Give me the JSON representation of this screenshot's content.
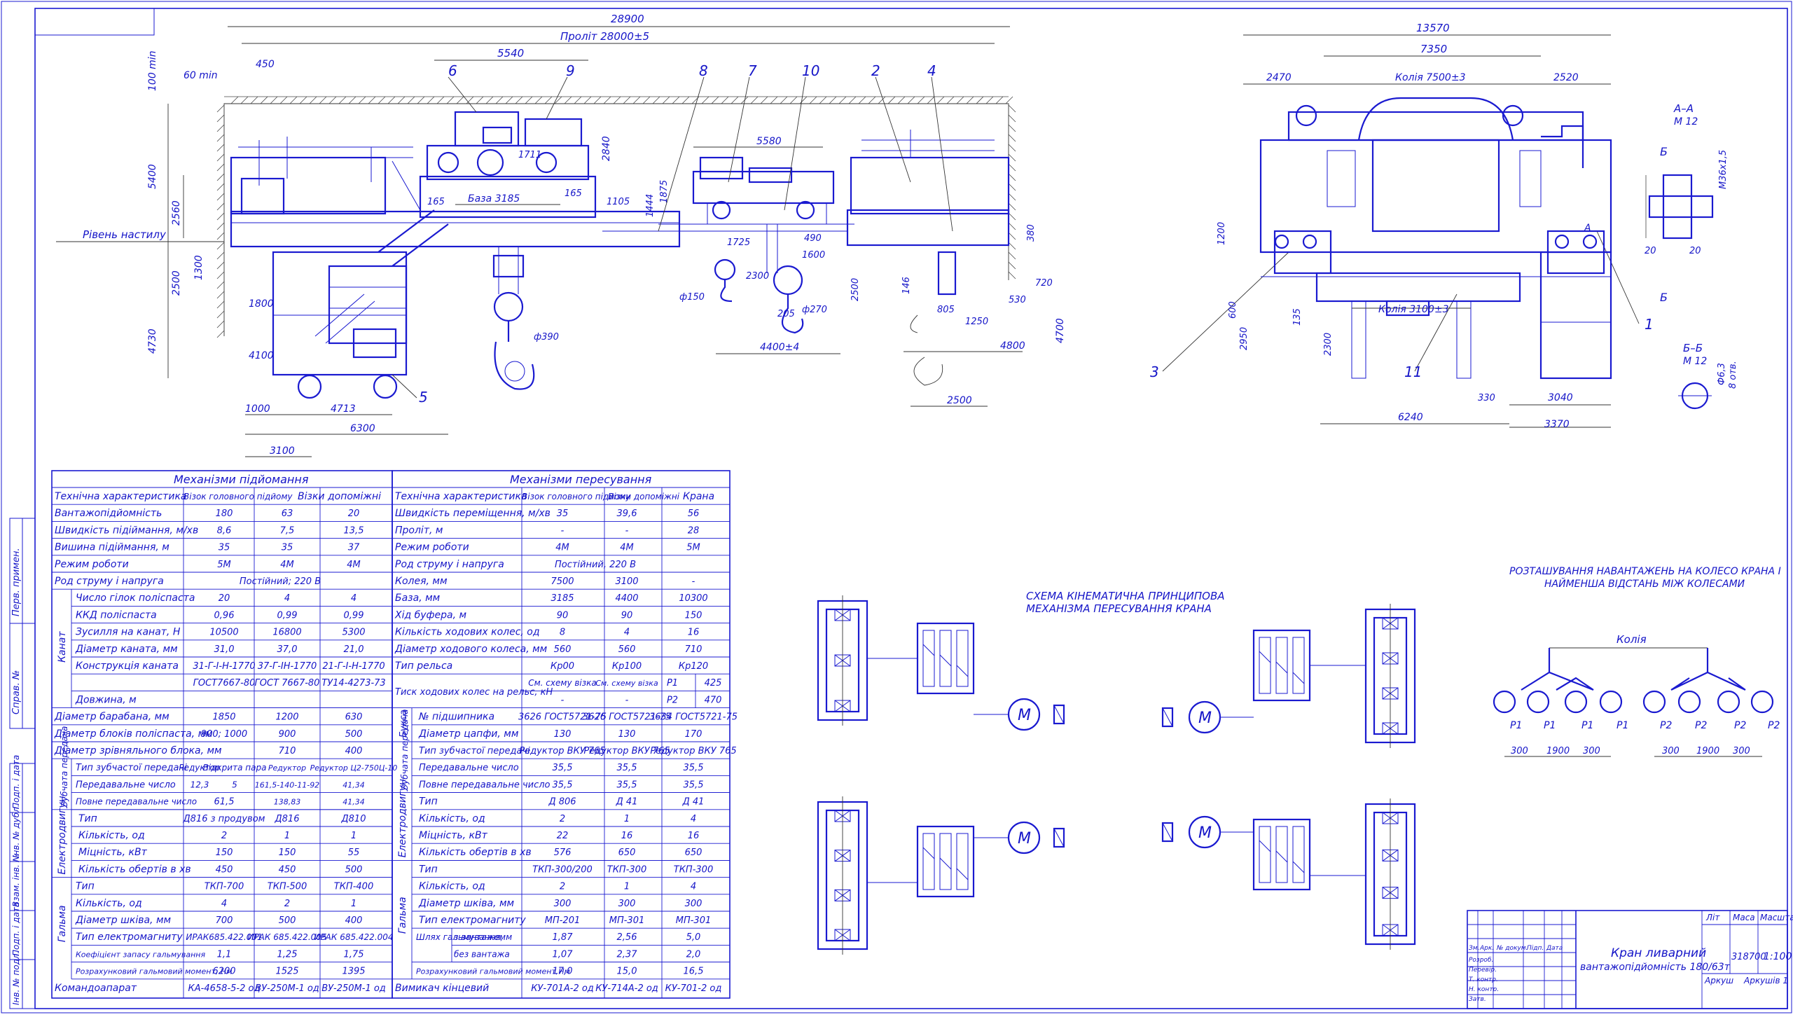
{
  "colors": {
    "line": "#1a1ad0",
    "text": "#1515c8",
    "dim": "#333333"
  },
  "drawing": {
    "dims_main": {
      "overall": "28900",
      "span": "Проліт 28000±5",
      "d5540": "5540",
      "d5580": "5580",
      "d4400": "4400±4",
      "d4800": "4800",
      "d4713": "4713",
      "d6300": "6300",
      "d3100": "3100",
      "d1000": "1000",
      "d2500": "2500",
      "d4100": "4100",
      "d1800": "1800",
      "d2500v": "2500",
      "d2560": "2560",
      "d1300": "1300",
      "d4730": "4730",
      "d5400": "5400",
      "d450": "450",
      "d60": "60 min",
      "d100": "100 min",
      "d2840": "2840",
      "d1711": "1711",
      "base": "База 3185",
      "d165a": "165",
      "d165b": "165",
      "d1105": "1105",
      "d1875": "1875",
      "d1444": "1444",
      "d1725": "1725",
      "d2300": "2300",
      "d490": "490",
      "d1600": "1600",
      "d146": "146",
      "d805": "805",
      "d1250": "1250",
      "d530": "530",
      "d720": "720",
      "d380": "380",
      "d2500b": "2500",
      "d4700": "4700",
      "phi390": "ф390",
      "phi150": "ф150",
      "phi270": "ф270",
      "d205": "205",
      "floor": "Рівень настилу"
    },
    "callouts": [
      "6",
      "9",
      "8",
      "7",
      "10",
      "2",
      "4",
      "5",
      "3",
      "11",
      "1"
    ],
    "dims_side": {
      "d13570": "13570",
      "d7350": "7350",
      "d2470": "2470",
      "track": "Колія 7500±3",
      "d2520": "2520",
      "track2": "Колія 3100±3",
      "d1200": "1200",
      "d600": "600",
      "d2950": "2950",
      "d135": "135",
      "d2300": "2300",
      "d330": "330",
      "d3040": "3040",
      "d6240": "6240",
      "d3370": "3370"
    },
    "sections": {
      "aa": "А–А",
      "aa_scale": "М 12",
      "bb": "Б–Б",
      "bb_scale": "М 12",
      "b1": "Б",
      "b2": "Б",
      "a": "А",
      "m36": "М36х1,5",
      "d20a": "20",
      "d20b": "20",
      "phi63": "Ф6,3",
      "holes": "8 отв."
    },
    "scheme": {
      "title1": "СХЕМА КІНЕМАТИЧНА ПРИНЦИПОВА",
      "title2": "МЕХАНІЗМА ПЕРЕСУВАННЯ КРАНА",
      "motor": "М"
    },
    "wheels": {
      "title1": "РОЗТАШУВАННЯ НАВАНТАЖЕНЬ НА КОЛЕСО КРАНА І",
      "title2": "НАЙМЕНША ВІДСТАНЬ МІЖ КОЛЕСАМИ",
      "track": "Колія",
      "p1": "Р1",
      "p2": "Р2",
      "d300": "300",
      "d1900": "1900"
    },
    "margin_labels": {
      "first_use": "Перв. примен.",
      "ref": "Справ. №",
      "inv": "Інв. № подл.",
      "sig": "Подп. і дата",
      "replace": "Взам. інв. №",
      "dup": "Інв. № дубл.",
      "sig2": "Подп. і дата"
    }
  },
  "titleblock": {
    "title": "Кран ливарний",
    "subtitle": "вантажопідйомність 180/63т",
    "lit": "Літ",
    "mass": "Маса",
    "scale": "Масштаб",
    "mass_val": "318700",
    "scale_val": "1:100",
    "sheet": "Аркуш",
    "sheets": "Аркушів 1",
    "rows": [
      "Зм.",
      "Арк.",
      "№ докум.",
      "Підп.",
      "Дата",
      "Розроб.",
      "Перевір.",
      "Т. контр.",
      "Н. контр.",
      "Затв."
    ]
  },
  "table_left": {
    "heading": "Механізми підйомання",
    "col_header": [
      "Технічна характеристика",
      "Візок головного підйому",
      "Візки допоміжні"
    ],
    "rows": [
      [
        "Вантажопідйомність",
        "180",
        "63",
        "20"
      ],
      [
        "Швидкість підіймання, м/хв",
        "8,6",
        "7,5",
        "13,5"
      ],
      [
        "Вишина підіймання, м",
        "35",
        "35",
        "37"
      ],
      [
        "Режим роботи",
        "5М",
        "4М",
        "4М"
      ],
      [
        "Род струму і напруга",
        "Постійний; 220 В",
        "",
        ""
      ]
    ],
    "group_rope": "Канат",
    "rope_rows": [
      [
        "Число гілок поліспаста",
        "20",
        "4",
        "4"
      ],
      [
        "ККД поліспаста",
        "0,96",
        "0,99",
        "0,99"
      ],
      [
        "Зусилля на канат, Н",
        "10500",
        "16800",
        "5300"
      ],
      [
        "Діаметр каната, мм",
        "31,0",
        "37,0",
        "21,0"
      ],
      [
        "Конструкція каната",
        "31-Г-І-Н-1770",
        "37-Г-ІН-1770",
        "21-Г-І-Н-1770"
      ],
      [
        "",
        "ГОСТ7667-80",
        "ГОСТ 7667-80",
        "ТУ14-4273-73"
      ],
      [
        "Довжина, м",
        "",
        "",
        ""
      ]
    ],
    "rows2": [
      [
        "Діаметр барабана, мм",
        "1850",
        "1200",
        "630"
      ],
      [
        "Діаметр блоків поліспаста, мм",
        "900; 1000",
        "900",
        "500"
      ],
      [
        "Діаметр зрівняльного блока, мм",
        "",
        "710",
        "400"
      ]
    ],
    "group_gear": "Зубчата передача",
    "gear_rows": [
      [
        "Тип зубчастої передачі",
        "Редуктор",
        "Відкрита пара",
        "Редуктор",
        "Редуктор Ц2-750Ц-10"
      ],
      [
        "Передавальне число",
        "12,3",
        "5",
        "161,5-140-11-92",
        "41,34"
      ],
      [
        "Повне передавальне число",
        "61,5",
        "",
        "138,83",
        "41,34"
      ]
    ],
    "group_motor": "Електродвигун",
    "motor_rows": [
      [
        "Тип",
        "Д816 з продувом",
        "Д816",
        "Д810"
      ],
      [
        "Кількість, од",
        "2",
        "1",
        "1"
      ],
      [
        "Міцність, кВт",
        "150",
        "150",
        "55"
      ],
      [
        "Кількість обертів в хв",
        "450",
        "450",
        "500"
      ]
    ],
    "group_brake": "Гальма",
    "brake_rows": [
      [
        "Тип",
        "ТКП-700",
        "ТКП-500",
        "ТКП-400"
      ],
      [
        "Кількість, од",
        "4",
        "2",
        "1"
      ],
      [
        "Діаметр шківа, мм",
        "700",
        "500",
        "400"
      ],
      [
        "Тип електромагниту",
        "ИРАК685.422.001",
        "ИРАК 685.422.005",
        "ИРАК 685.422.004"
      ],
      [
        "Коефіцієнт запасу гальмування",
        "1,1",
        "1,25",
        "1,75"
      ],
      [
        "Розрахунковий гальмовий момент, Нм",
        "6200",
        "1525",
        "1395"
      ]
    ],
    "last_row": [
      "Командоапарат",
      "КА-4658-5-2 од",
      "ВУ-250М-1 од",
      "ВУ-250М-1 од"
    ]
  },
  "table_right": {
    "heading": "Механізми пересування",
    "col_header": [
      "Технічна характеристика",
      "Візок головного підйому",
      "Візки допоміжні",
      "Крана"
    ],
    "rows": [
      [
        "Швидкість переміщення, м/хв",
        "35",
        "39,6",
        "56"
      ],
      [
        "Проліт, м",
        "-",
        "-",
        "28"
      ],
      [
        "Режим роботи",
        "4М",
        "4М",
        "5М"
      ],
      [
        "Род струму і напруга",
        "Постійний, 220 В",
        "",
        ""
      ],
      [
        "Колея, мм",
        "7500",
        "3100",
        "-"
      ],
      [
        "База, мм",
        "3185",
        "4400",
        "10300"
      ],
      [
        "Хід буфера, м",
        "90",
        "90",
        "150"
      ],
      [
        "Кількість ходових колес, од",
        "8",
        "4",
        "16"
      ],
      [
        "Діаметр ходового колеса, мм",
        "560",
        "560",
        "710"
      ],
      [
        "Тип рельса",
        "Кр00",
        "Кр100",
        "Кр120"
      ],
      [
        "Тиск ходових колес на рельс, кН",
        "См. схему візка",
        "См. схему візка",
        "Р1",
        "425"
      ],
      [
        "",
        "-",
        "-",
        "Р2",
        "470"
      ]
    ],
    "group_box": "Букса",
    "box_rows": [
      [
        "№ підшипника",
        "3626 ГОСТ5721-75",
        "3626 ГОСТ5721-75",
        "3634 ГОСТ5721-75"
      ],
      [
        "Діаметр цапфи, мм",
        "130",
        "130",
        "170"
      ]
    ],
    "group_gear": "Зубчата передача",
    "gear_rows": [
      [
        "Тип зубчастої передачі",
        "Редуктор ВКУ 765",
        "Редуктор ВКУ 765",
        "Редуктор ВКУ 765"
      ],
      [
        "Передавальне число",
        "35,5",
        "35,5",
        "35,5"
      ],
      [
        "Повне передавальне число",
        "35,5",
        "35,5",
        "35,5"
      ]
    ],
    "group_motor": "Електродвигун",
    "motor_rows": [
      [
        "Тип",
        "Д 806",
        "Д 41",
        "Д 41"
      ],
      [
        "Кількість, од",
        "2",
        "1",
        "4"
      ],
      [
        "Міцність, кВт",
        "22",
        "16",
        "16"
      ],
      [
        "Кількість обертів в хв",
        "576",
        "650",
        "650"
      ]
    ],
    "group_brake": "Гальма",
    "brake_rows": [
      [
        "Тип",
        "ТКП-300/200",
        "ТКП-300",
        "ТКП-300"
      ],
      [
        "Кількість, од",
        "2",
        "1",
        "4"
      ],
      [
        "Діаметр шківа, мм",
        "300",
        "300",
        "300"
      ],
      [
        "Тип електромагниту",
        "МП-201",
        "МП-301",
        "МП-301"
      ]
    ],
    "path_label": "Шлях гальмування, м",
    "path_rows": [
      [
        "з вантажем",
        "1,87",
        "2,56",
        "5,0"
      ],
      [
        "без вантажа",
        "1,07",
        "2,37",
        "2,0"
      ]
    ],
    "moment_row": [
      "Розрахунковий гальмовий момент,Нм",
      "17,0",
      "15,0",
      "16,5"
    ],
    "last_row": [
      "Вимикач кінцевий",
      "КУ-701А-2 од",
      "КУ-714А-2 од",
      "КУ-701-2 од"
    ]
  }
}
